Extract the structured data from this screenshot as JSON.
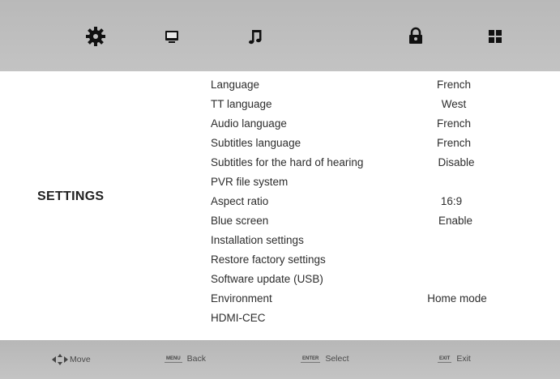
{
  "top_tabs": [
    {
      "icon": "gear-icon"
    },
    {
      "icon": "monitor-icon"
    },
    {
      "icon": "music-note-icon"
    },
    {
      "icon": "lock-icon"
    },
    {
      "icon": "apps-grid-icon"
    }
  ],
  "section_title": "SETTINGS",
  "menu": [
    {
      "label": "Language",
      "value": "French"
    },
    {
      "label": "TT language",
      "value": "West"
    },
    {
      "label": "Audio language",
      "value": "French"
    },
    {
      "label": "Subtitles language",
      "value": "French"
    },
    {
      "label": "Subtitles for the hard of hearing",
      "value": "Disable"
    },
    {
      "label": "PVR file system",
      "value": ""
    },
    {
      "label": "Aspect ratio",
      "value": "16:9"
    },
    {
      "label": "Blue screen",
      "value": "Enable"
    },
    {
      "label": "Installation settings",
      "value": ""
    },
    {
      "label": "Restore factory settings",
      "value": ""
    },
    {
      "label": "Software update (USB)",
      "value": ""
    },
    {
      "label": "Environment",
      "value": "Home mode"
    },
    {
      "label": "HDMI-CEC",
      "value": ""
    }
  ],
  "bottom_hints": {
    "move": {
      "label": "Move"
    },
    "back": {
      "key": "MENU",
      "label": "Back"
    },
    "select": {
      "key": "ENTER",
      "label": "Select"
    },
    "exit": {
      "key": "EXIT",
      "label": "Exit"
    }
  }
}
